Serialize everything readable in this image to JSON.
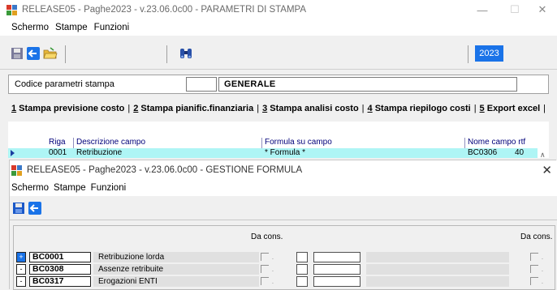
{
  "window": {
    "title": "RELEASE05 - Paghe2023 - v.23.06.0c00 - PARAMETRI DI STAMPA",
    "controls": {
      "minimize": "—",
      "maximize": "☐",
      "close": "✕"
    }
  },
  "menu": [
    "Schermo",
    "Stampe",
    "Funzioni"
  ],
  "toolbar": {
    "year": "2023"
  },
  "codice": {
    "label": "Codice parametri stampa",
    "small_value": "",
    "value": "GENERALE"
  },
  "tabs": [
    {
      "num": "1",
      "label": " Stampa previsione costo"
    },
    {
      "num": "2",
      "label": " Stampa pianific.finanziaria"
    },
    {
      "num": "3",
      "label": " Stampa analisi costo"
    },
    {
      "num": "4",
      "label": " Stampa riepilogo costi"
    },
    {
      "num": "5",
      "label": " Export excel"
    }
  ],
  "grid": {
    "headers": {
      "riga": "Riga",
      "descrizione": "Descrizione campo",
      "formula": "Formula su campo",
      "nome": "Nome campo rtf"
    },
    "row": {
      "riga": "0001",
      "descrizione": "Retribuzione",
      "formula": "* Formula *",
      "nome": "BC0306",
      "num": "40"
    }
  },
  "inner": {
    "title": "RELEASE05 - Paghe2023 - v.23.06.0c00 - GESTIONE FORMULA",
    "close": "✕",
    "menu": [
      "Schermo",
      "Stampe",
      "Funzioni"
    ],
    "col_head_1": "Da cons.",
    "col_head_2": "Da cons.",
    "rows": [
      {
        "expand": "+",
        "code": "BC0001",
        "desc": "Retribuzione lorda"
      },
      {
        "expand": "-",
        "code": "BC0308",
        "desc": "Assenze retribuite"
      },
      {
        "expand": "-",
        "code": "BC0317",
        "desc": "Erogazioni ENTI"
      }
    ]
  },
  "icons": [
    "app-logo-icon",
    "save-icon",
    "back-arrow-icon",
    "open-folder-icon",
    "binoculars-icon"
  ],
  "colors": {
    "accent": "#1a73e8",
    "grid_selected_row": "#aef5f5",
    "grid_header_text": "#00007a"
  }
}
